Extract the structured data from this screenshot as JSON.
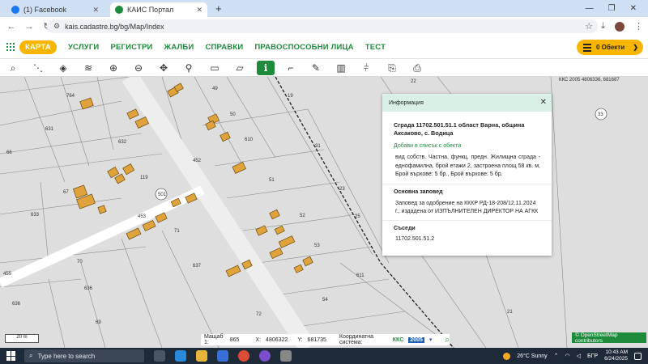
{
  "browser": {
    "tabs": [
      {
        "title": "(1) Facebook",
        "active": false
      },
      {
        "title": "КАИС Портал",
        "active": true
      }
    ],
    "new_tab": "+",
    "url": "kais.cadastre.bg/bg/Map/Index"
  },
  "nav": {
    "items": [
      "КАРТА",
      "УСЛУГИ",
      "РЕГИСТРИ",
      "ЖАЛБИ",
      "СПРАВКИ",
      "ПРАВОСПОСОБНИ ЛИЦА",
      "ТЕСТ"
    ],
    "active": "КАРТА",
    "objects_button": "0 Обекти"
  },
  "toolbar": {
    "icons": [
      "search-icon",
      "measure-icon",
      "layers-icon",
      "layers-stack-icon",
      "zoom-in-icon",
      "zoom-out-icon",
      "pan-icon",
      "location-pin-icon",
      "select-rect-icon",
      "select-rect-alt-icon",
      "info-icon",
      "draw-icon",
      "edit-icon",
      "map-icon",
      "split-icon",
      "export-icon",
      "print-icon"
    ],
    "active_icon": "info-icon"
  },
  "map": {
    "coord_tag": "ККС 2005 4806336, 681687",
    "parcel_labels": [
      "764",
      "631",
      "66",
      "632",
      "119",
      "67",
      "633",
      "453",
      "71",
      "637",
      "70",
      "636",
      "636",
      "69",
      "49",
      "50",
      "610",
      "452",
      "51",
      "52",
      "53",
      "54",
      "22",
      "19",
      "31",
      "23",
      "25",
      "611",
      "72",
      "501",
      "455",
      "33",
      "21"
    ],
    "scale_label": "20 m",
    "osm_credit": "© OpenStreetMap contributors"
  },
  "info_panel": {
    "header": "Информация",
    "title": "Сграда 11702.501.51.1 област Варна, община Аксаково, с. Водица",
    "add_link": "Добави в списък с обекти",
    "description": "вид собств. Частна, функц. предн. Жилищна сграда - еднофамилна, брой етажи 2, застроена площ 58 кв. м, Брой върхове: 5 бр., Брой върхове: 5 бр.",
    "section_order": "Основна заповед",
    "order_text": "Заповед за одобрение на КККР РД-18-208/12.11.2024 г., издадена от ИЗПЪЛНИТЕЛЕН ДИРЕКТОР НА АГКК",
    "section_neighbors": "Съседи",
    "neighbor": "11702.501.51.2"
  },
  "statusbar": {
    "scale_label": "Мащаб 1:",
    "scale_value": "865",
    "x_label": "X:",
    "x_value": "4806322",
    "y_label": "Y:",
    "y_value": "681735",
    "cs_label": "Координатна система:",
    "cs_prefix": "ККС",
    "cs_value": "2005"
  },
  "taskbar": {
    "search_placeholder": "Type here to search",
    "weather": "26°C  Sunny",
    "lang": "БГР",
    "time": "10:43 AM",
    "date": "6/24/2025"
  },
  "colors": {
    "brand_green": "#1e8a3c",
    "accent_yellow": "#f7b500",
    "building_fill": "#e0a23a",
    "panel_header": "#d9f0e6"
  }
}
